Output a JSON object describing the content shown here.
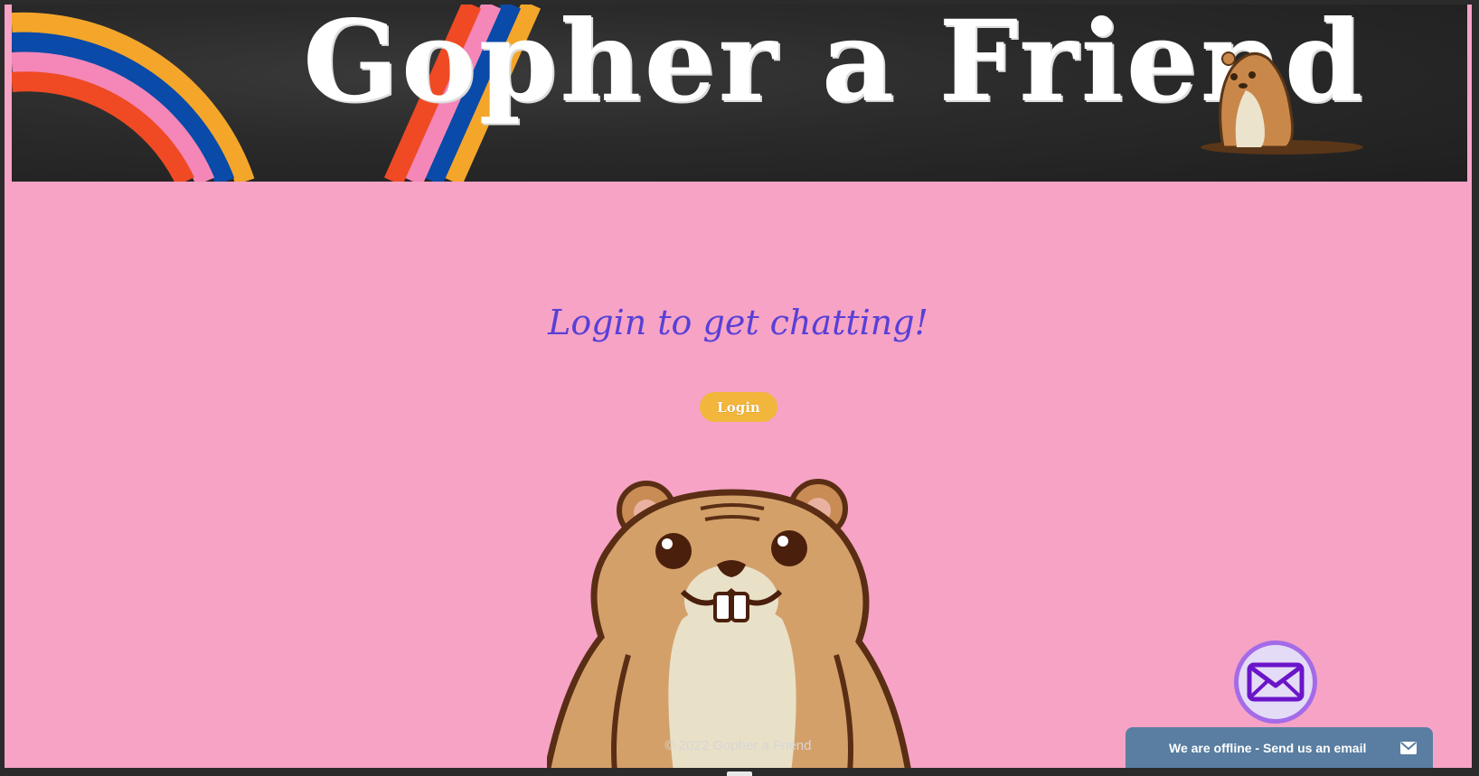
{
  "banner": {
    "title": "Gopher a Friend",
    "stripe_colors": [
      "#f4a62a",
      "#0a4aa8",
      "#f487b8",
      "#ef4a24"
    ]
  },
  "main": {
    "heading": "Login to get chatting!",
    "login_label": "Login",
    "heading_color": "#5840d6",
    "button_color": "#f2b63c",
    "background_color": "#f6a3c6"
  },
  "footer": {
    "copyright": "© 2022 Gopher a Friend"
  },
  "chat_widget": {
    "status_text": "We are offline - Send us an email",
    "bubble_icon": "envelope-icon",
    "bar_icon": "envelope-icon",
    "bar_color": "#597ea1"
  }
}
